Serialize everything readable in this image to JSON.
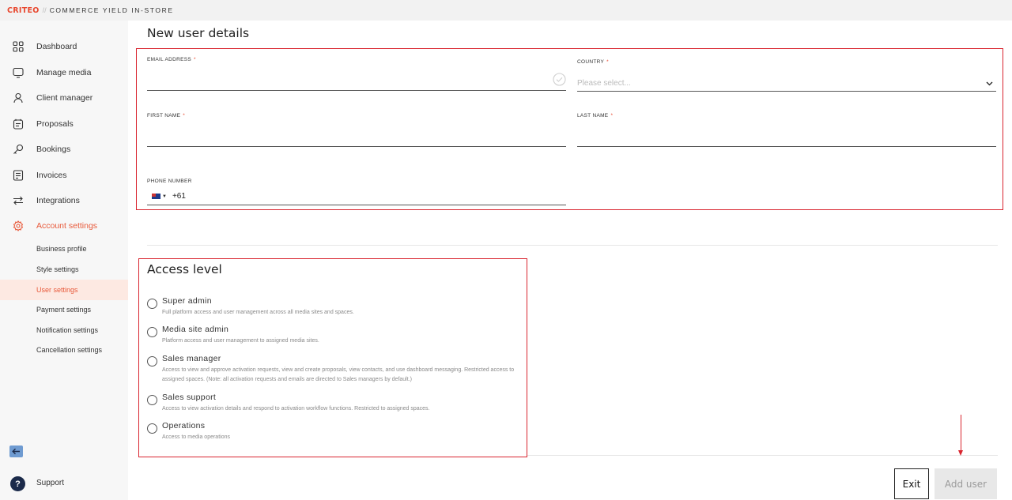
{
  "header": {
    "brand": "CRITEO",
    "separator": "//",
    "product": "COMMERCE YIELD IN-STORE"
  },
  "sidebar": {
    "items": [
      {
        "label": "Dashboard",
        "icon": "grid-icon"
      },
      {
        "label": "Manage media",
        "icon": "monitor-icon"
      },
      {
        "label": "Client manager",
        "icon": "user-icon"
      },
      {
        "label": "Proposals",
        "icon": "proposal-icon"
      },
      {
        "label": "Bookings",
        "icon": "key-icon"
      },
      {
        "label": "Invoices",
        "icon": "invoice-icon"
      },
      {
        "label": "Integrations",
        "icon": "swap-arrows-icon"
      },
      {
        "label": "Account settings",
        "icon": "gear-icon",
        "active": true
      }
    ],
    "sub_items": [
      {
        "label": "Business profile"
      },
      {
        "label": "Style settings"
      },
      {
        "label": "User settings",
        "active": true
      },
      {
        "label": "Payment settings"
      },
      {
        "label": "Notification settings"
      },
      {
        "label": "Cancellation settings"
      }
    ],
    "support_label": "Support",
    "support_symbol": "?"
  },
  "user_details": {
    "title": "New user details",
    "email_label": "EMAIL ADDRESS",
    "email_value": "",
    "country_label": "COUNTRY",
    "country_placeholder": "Please select...",
    "first_name_label": "FIRST NAME",
    "first_name_value": "",
    "last_name_label": "LAST NAME",
    "last_name_value": "",
    "phone_label": "PHONE NUMBER",
    "phone_code": "+61",
    "required_mark": "*"
  },
  "access_level": {
    "title": "Access level",
    "options": [
      {
        "title": "Super admin",
        "desc": "Full platform access and user management across all media sites and spaces."
      },
      {
        "title": "Media site admin",
        "desc": "Platform access and user management to assigned media sites."
      },
      {
        "title": "Sales manager",
        "desc": "Access to view and approve activation requests, view and create proposals, view contacts, and use dashboard messaging. Restricted access to assigned spaces. (Note: all activation requests and emails are directed to Sales managers by default.)"
      },
      {
        "title": "Sales support",
        "desc": "Access to view activation details and respond to activation workflow functions. Restricted to assigned spaces."
      },
      {
        "title": "Operations",
        "desc": "Access to media operations"
      }
    ]
  },
  "actions": {
    "exit_label": "Exit",
    "add_user_label": "Add user"
  },
  "colors": {
    "accent": "#e8593a",
    "annotation_red": "#d9252f",
    "sidebar_bg": "#f7f7f7"
  }
}
